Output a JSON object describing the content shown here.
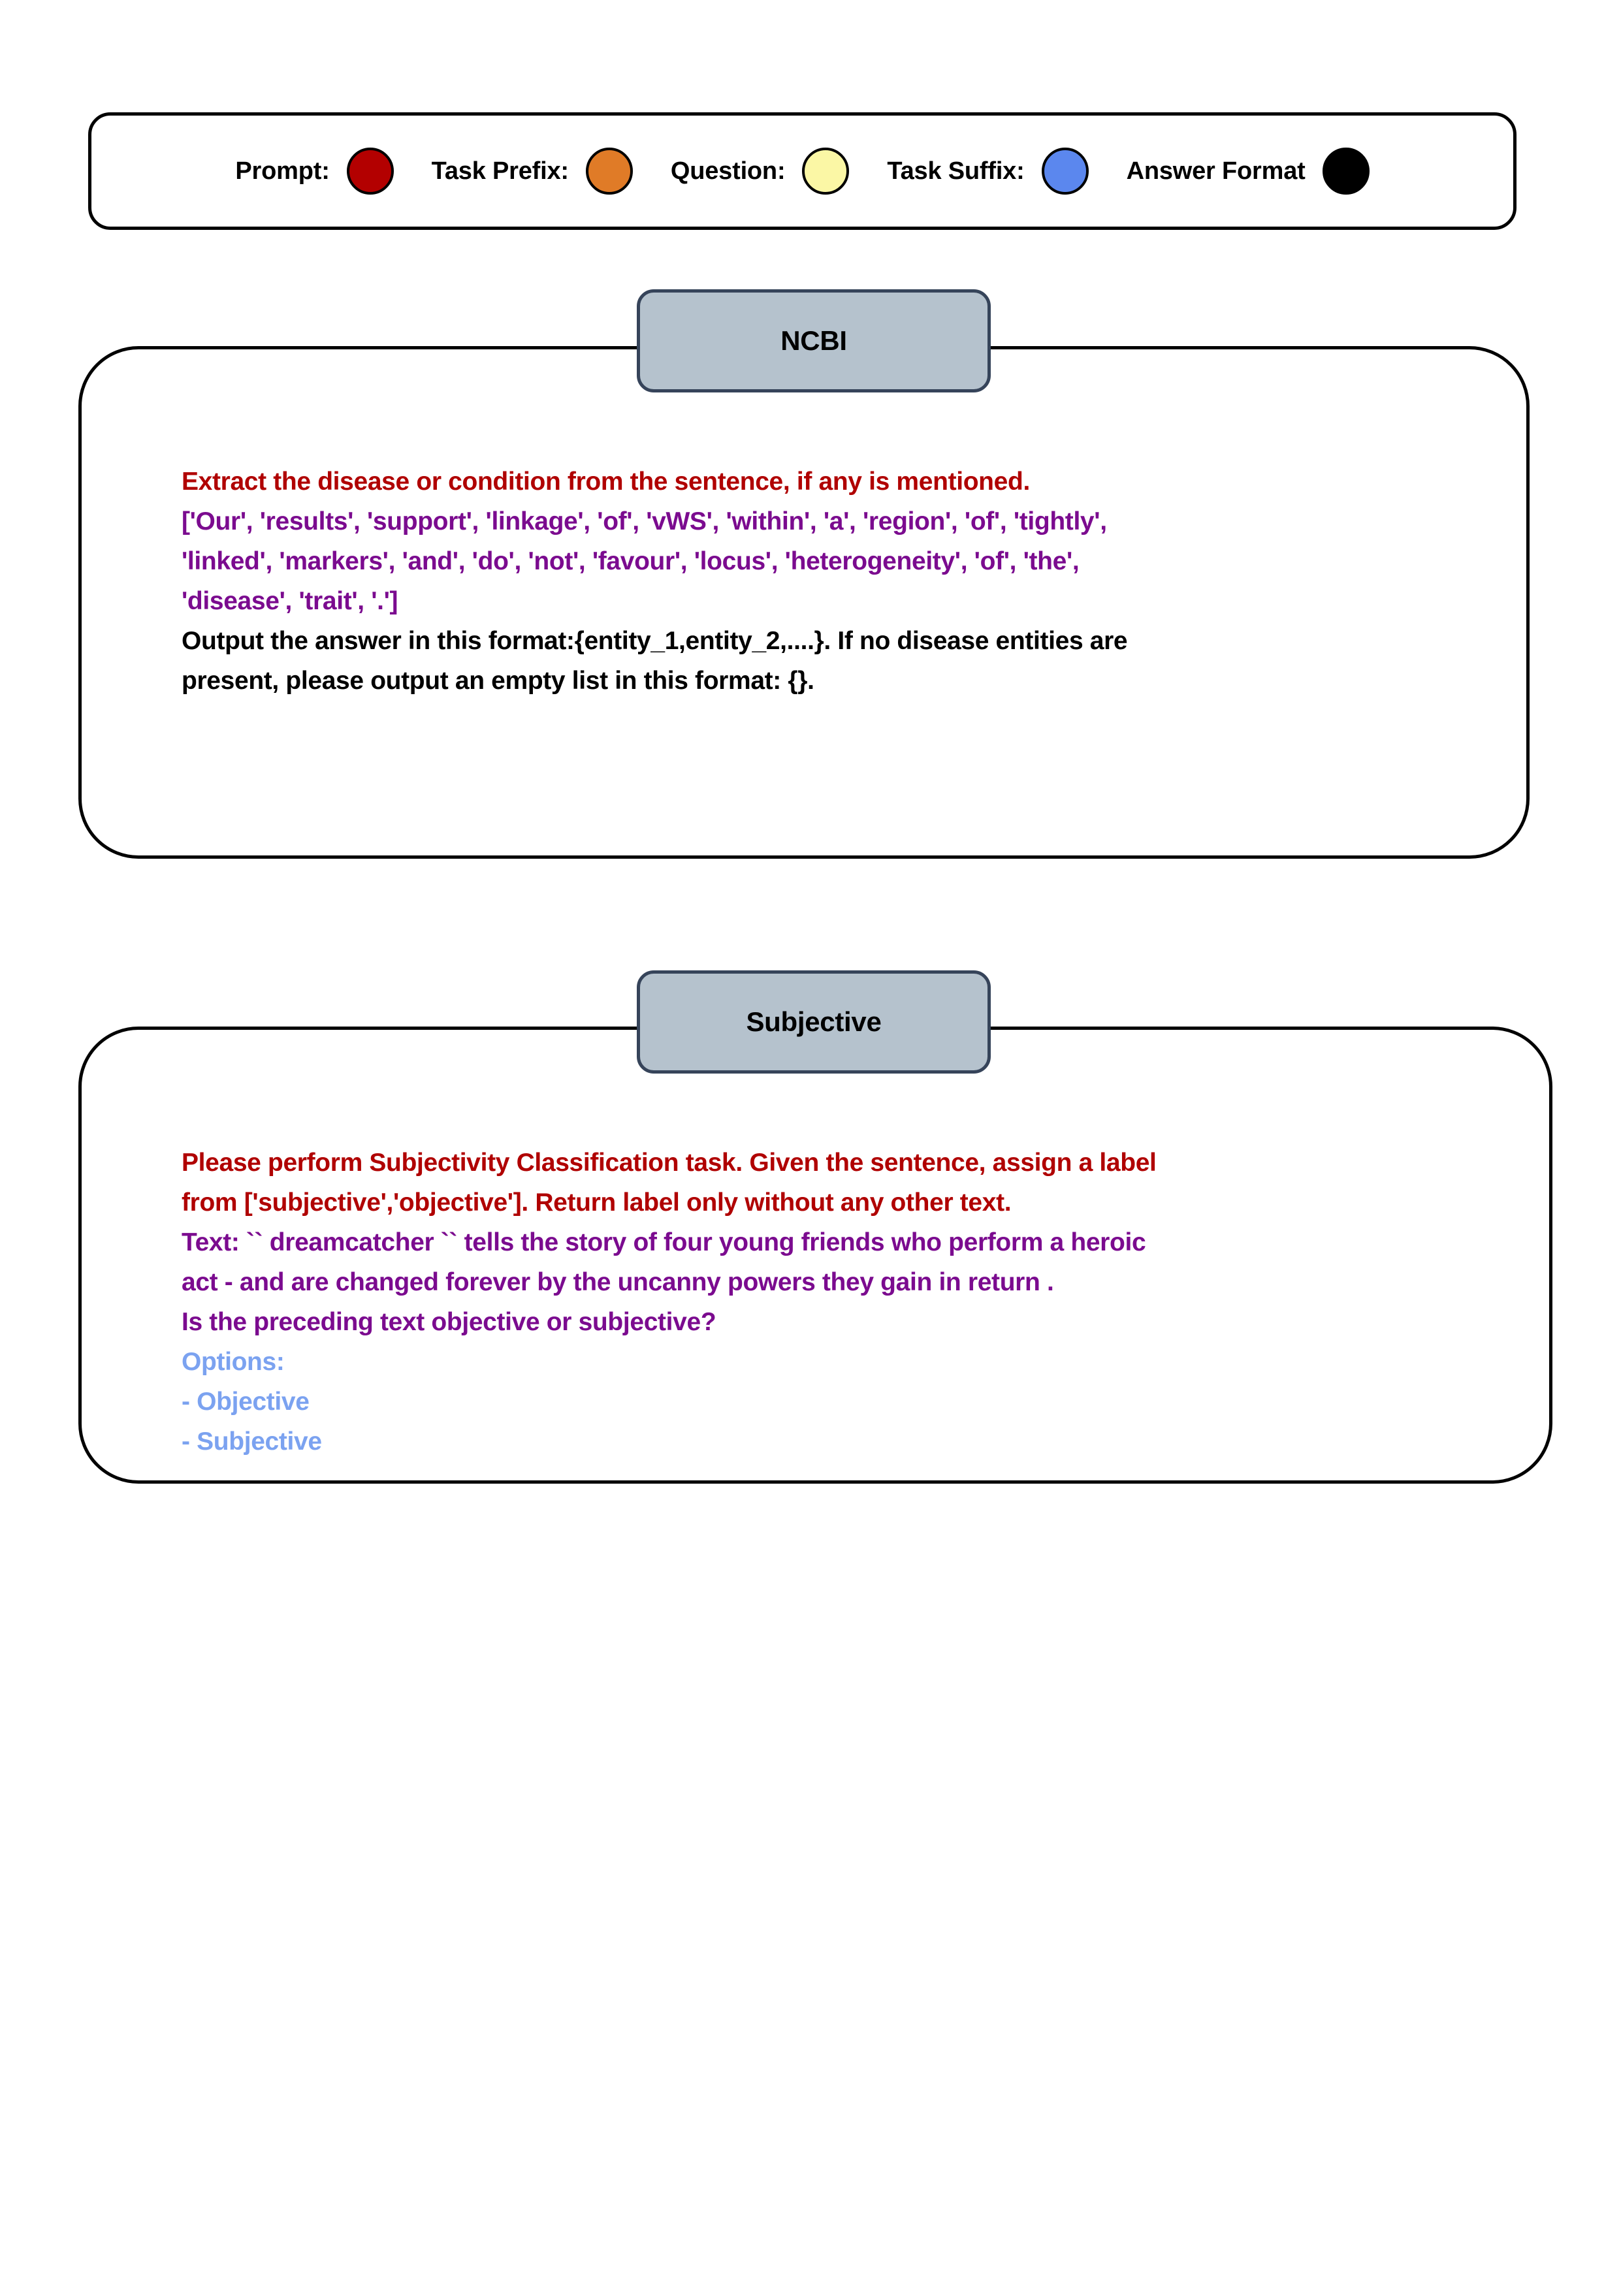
{
  "legend": {
    "items": [
      {
        "label": "Prompt:",
        "color": "#b30000",
        "icon": "circle-swatch-icon",
        "name": "legend-swatch-prompt"
      },
      {
        "label": "Task Prefix:",
        "color": "#e07b27",
        "icon": "circle-swatch-icon",
        "name": "legend-swatch-task-prefix"
      },
      {
        "label": "Question:",
        "color": "#fbf7a5",
        "icon": "circle-swatch-icon",
        "name": "legend-swatch-question"
      },
      {
        "label": "Task Suffix:",
        "color": "#5b87ee",
        "icon": "circle-swatch-icon",
        "name": "legend-swatch-task-suffix"
      },
      {
        "label": "Answer Format",
        "color": "#000000",
        "icon": "circle-swatch-icon",
        "name": "legend-swatch-answer-format"
      }
    ]
  },
  "cards": [
    {
      "title": "NCBI",
      "lines": [
        {
          "text": "Extract the disease or condition from the sentence, if any is mentioned.",
          "role": "prompt"
        },
        {
          "text": "['Our', 'results', 'support', 'linkage', 'of', 'vWS', 'within', 'a', 'region', 'of', 'tightly',",
          "role": "question"
        },
        {
          "text": "'linked', 'markers', 'and', 'do', 'not', 'favour', 'locus', 'heterogeneity', 'of', 'the',",
          "role": "question"
        },
        {
          "text": "'disease', 'trait', '.']",
          "role": "question"
        },
        {
          "text": "Output the answer in this format:{entity_1,entity_2,....}. If no disease entities are",
          "role": "answer"
        },
        {
          "text": "present, please output an empty list in this format: {}.",
          "role": "answer"
        }
      ]
    },
    {
      "title": "Subjective",
      "lines": [
        {
          "text": "Please perform Subjectivity Classification task. Given the sentence, assign a label",
          "role": "prompt"
        },
        {
          "text": "from ['subjective','objective']. Return label only without any other text.",
          "role": "prompt"
        },
        {
          "text": "Text: `` dreamcatcher `` tells the story of four young friends who perform a heroic",
          "role": "question"
        },
        {
          "text": "act - and are changed forever by the uncanny powers they gain in return .",
          "role": "question"
        },
        {
          "text": "Is the preceding text objective or subjective?",
          "role": "question"
        },
        {
          "text": "Options:",
          "role": "options"
        },
        {
          "text": "- Objective",
          "role": "options"
        },
        {
          "text": "- Subjective",
          "role": "options"
        }
      ]
    }
  ],
  "colors": {
    "prompt_text": "#b00000",
    "question_text": "#7b0b8f",
    "answer_text": "#000000",
    "options_text": "#7ba2f0",
    "header_fill": "#b5c2cd",
    "header_border": "#36445a",
    "card_border": "#000000",
    "page_background": "#ffffff"
  }
}
